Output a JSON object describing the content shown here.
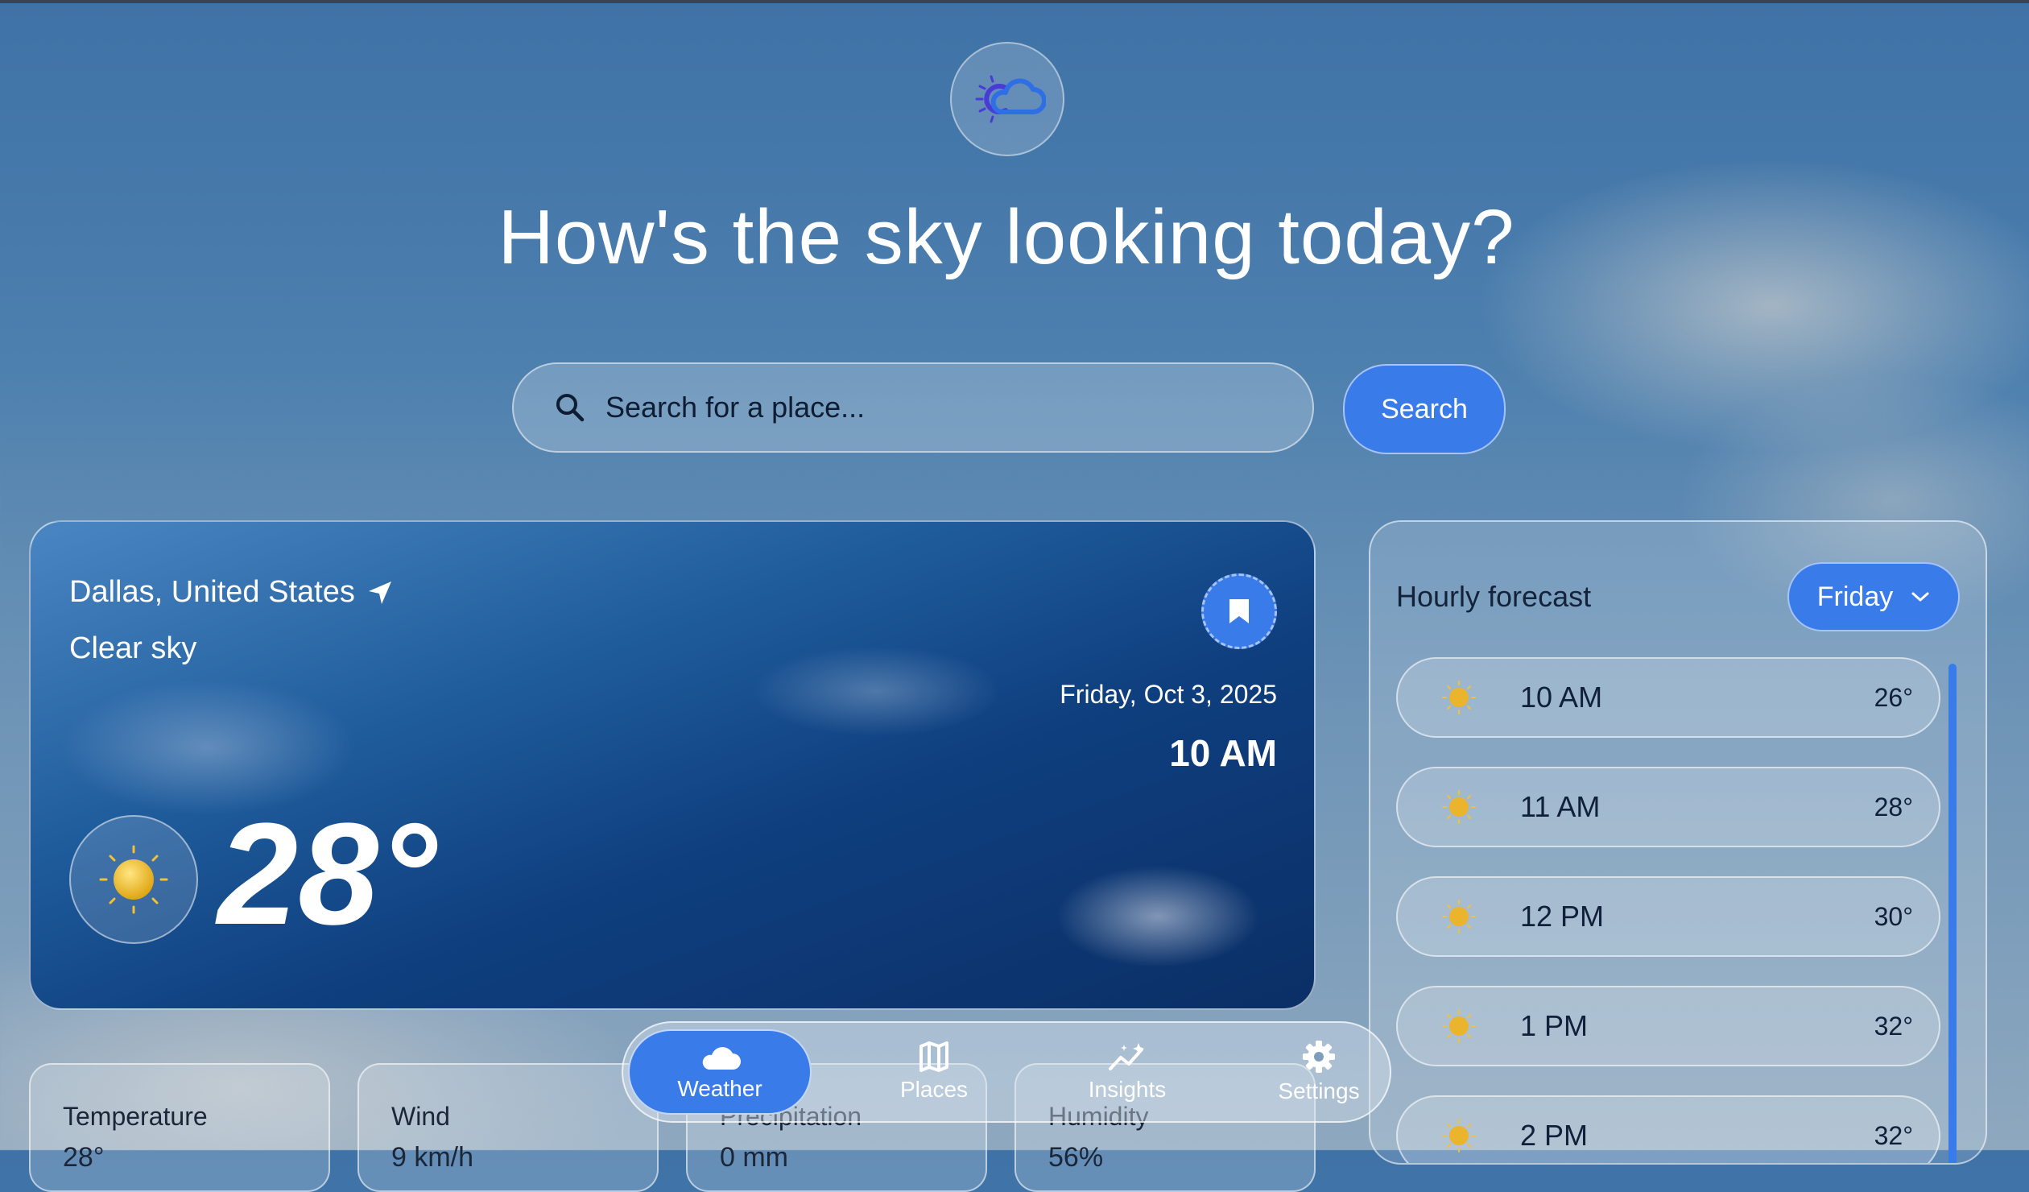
{
  "app": {
    "headline": "How's the sky looking today?",
    "logo_icon": "cloud-sun-logo-icon"
  },
  "search": {
    "placeholder": "Search for a place...",
    "value": "",
    "button_label": "Search"
  },
  "current": {
    "location": "Dallas, United States",
    "condition": "Clear sky",
    "date": "Friday, Oct 3, 2025",
    "time": "10 AM",
    "temperature": "28°",
    "condition_icon": "sun-icon"
  },
  "hourly": {
    "title": "Hourly forecast",
    "selected_day": "Friday",
    "rows": [
      {
        "time": "10 AM",
        "temp": "26°",
        "icon": "sun-icon"
      },
      {
        "time": "11 AM",
        "temp": "28°",
        "icon": "sun-icon"
      },
      {
        "time": "12 PM",
        "temp": "30°",
        "icon": "sun-icon"
      },
      {
        "time": "1 PM",
        "temp": "32°",
        "icon": "sun-icon"
      },
      {
        "time": "2 PM",
        "temp": "32°",
        "icon": "sun-icon"
      }
    ]
  },
  "stats": [
    {
      "label": "Temperature",
      "value": "28°"
    },
    {
      "label": "Wind",
      "value": "9 km/h"
    },
    {
      "label": "Precipitation",
      "value": "0 mm"
    },
    {
      "label": "Humidity",
      "value": "56%"
    }
  ],
  "nav": {
    "items": [
      {
        "label": "Weather",
        "icon": "cloud-icon",
        "active": true
      },
      {
        "label": "Places",
        "icon": "map-icon",
        "active": false
      },
      {
        "label": "Insights",
        "icon": "trend-sparkle-icon",
        "active": false
      },
      {
        "label": "Settings",
        "icon": "gear-icon",
        "active": false
      }
    ]
  },
  "colors": {
    "accent": "#3a7bea",
    "sun": "#f2c232"
  }
}
